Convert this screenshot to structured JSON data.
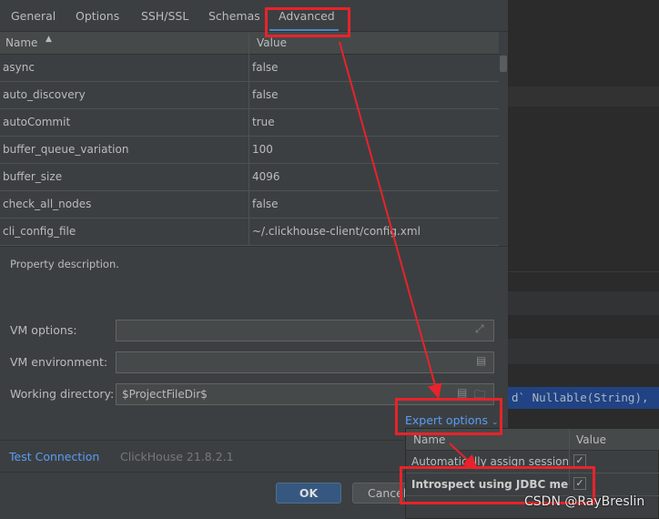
{
  "tabs": [
    {
      "label": "General"
    },
    {
      "label": "Options"
    },
    {
      "label": "SSH/SSL"
    },
    {
      "label": "Schemas"
    },
    {
      "label": "Advanced",
      "active": true
    }
  ],
  "table": {
    "headers": {
      "name": "Name",
      "value": "Value"
    },
    "sort_icon": "sort-ascending-icon",
    "rows": [
      {
        "name": "async",
        "value": "false"
      },
      {
        "name": "auto_discovery",
        "value": "false"
      },
      {
        "name": "autoCommit",
        "value": "true"
      },
      {
        "name": "buffer_queue_variation",
        "value": "100"
      },
      {
        "name": "buffer_size",
        "value": "4096"
      },
      {
        "name": "check_all_nodes",
        "value": "false"
      },
      {
        "name": "cli_config_file",
        "value": "~/.clickhouse-client/config.xml"
      }
    ]
  },
  "description": "Property description.",
  "form": {
    "vm_options_label": "VM options:",
    "vm_options_value": "",
    "vm_env_label": "VM environment:",
    "vm_env_value": "",
    "workdir_label": "Working directory:",
    "workdir_value": "$ProjectFileDir$"
  },
  "expert_options": "Expert options",
  "footer": {
    "test_connection": "Test Connection",
    "version": "ClickHouse 21.8.2.1",
    "ok": "OK",
    "cancel": "Cancel"
  },
  "expert_popup": {
    "headers": {
      "name": "Name",
      "value": "Value"
    },
    "rows": [
      {
        "name": "Automatically assign sessionid",
        "checked": true
      },
      {
        "name": "Introspect using JDBC meta",
        "checked": true
      }
    ]
  },
  "editor": {
    "code_line": "d` Nullable(String),"
  },
  "watermark": "CSDN @RayBreslin",
  "colors": {
    "accent": "#4a88c7",
    "annotation": "#e8232b",
    "dialog_bg": "#3c3f41"
  }
}
